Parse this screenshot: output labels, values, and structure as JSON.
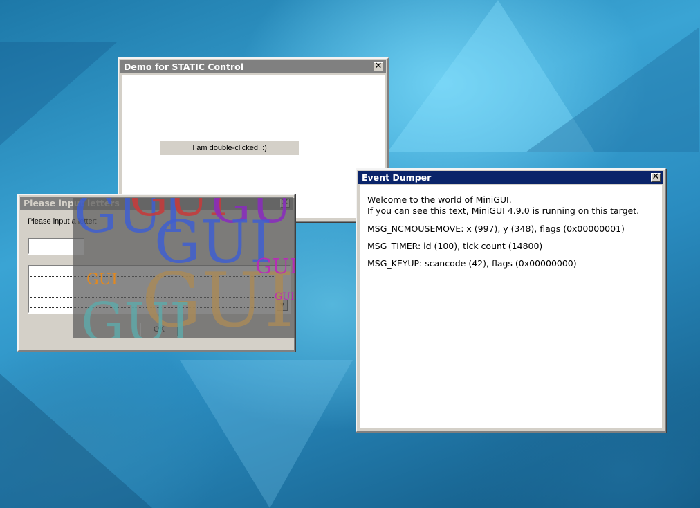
{
  "windows": {
    "static_demo": {
      "title": "Demo for STATIC Control",
      "label_text": "I am double-clicked. :)",
      "close_glyph": "✕"
    },
    "event_dumper": {
      "title": "Event Dumper",
      "close_glyph": "✕",
      "lines": [
        "Welcome to the world of MiniGUI.",
        "If you can see this text, MiniGUI 4.9.0 is running on this target.",
        "MSG_NCMOUSEMOVE: x (997), y (348), flags (0x00000001)",
        "MSG_TIMER: id (100), tick count (14800)",
        "MSG_KEYUP: scancode (42), flags (0x00000000)"
      ]
    },
    "input_letters": {
      "title": "Please input letters",
      "close_glyph": "✕",
      "prompt": "Please input a letter:",
      "edit_value": "",
      "ok_label": "OK"
    }
  },
  "overlay": {
    "gui_word": "GUI",
    "colors": {
      "blue": "#3f5fd0",
      "red": "#c83a3a",
      "purple": "#8a2bbf",
      "magenta": "#c020c0",
      "orange": "#f08a10",
      "tan": "#a88a5a",
      "teal": "#5fa8a8"
    }
  },
  "colors": {
    "active_title": "#0a246a",
    "inactive_title": "#808080",
    "dialog_face": "#d4d0c8"
  }
}
